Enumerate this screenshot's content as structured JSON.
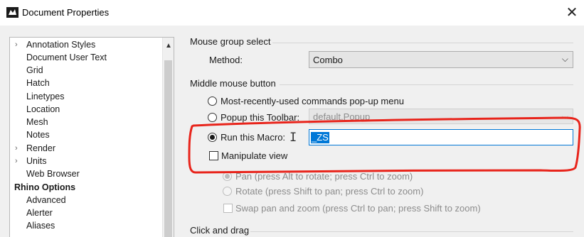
{
  "window": {
    "title": "Document Properties",
    "close_glyph": "✕"
  },
  "tree": {
    "items": [
      {
        "label": "Annotation Styles",
        "expandable": true,
        "level": 1
      },
      {
        "label": "Document User Text",
        "expandable": false,
        "level": 1
      },
      {
        "label": "Grid",
        "expandable": false,
        "level": 1
      },
      {
        "label": "Hatch",
        "expandable": false,
        "level": 1
      },
      {
        "label": "Linetypes",
        "expandable": false,
        "level": 1
      },
      {
        "label": "Location",
        "expandable": false,
        "level": 1
      },
      {
        "label": "Mesh",
        "expandable": false,
        "level": 1
      },
      {
        "label": "Notes",
        "expandable": false,
        "level": 1
      },
      {
        "label": "Render",
        "expandable": true,
        "level": 1
      },
      {
        "label": "Units",
        "expandable": true,
        "level": 1
      },
      {
        "label": "Web Browser",
        "expandable": false,
        "level": 1
      },
      {
        "label": "Rhino Options",
        "expandable": false,
        "level": 0
      },
      {
        "label": "Advanced",
        "expandable": false,
        "level": 1
      },
      {
        "label": "Alerter",
        "expandable": false,
        "level": 1
      },
      {
        "label": "Aliases",
        "expandable": false,
        "level": 1
      }
    ]
  },
  "mouse_group": {
    "title": "Mouse group select",
    "method_label": "Method:",
    "method_value": "Combo"
  },
  "middle_button": {
    "title": "Middle mouse button",
    "opt_popup_menu": "Most-recently-used commands pop-up menu",
    "opt_popup_toolbar": "Popup this Toolbar:",
    "toolbar_value": "default.Popup",
    "opt_run_macro": "Run this Macro:",
    "macro_value": "_ZS",
    "manipulate_view": "Manipulate view",
    "pan_option": "Pan (press Alt to rotate; press Ctrl to zoom)",
    "rotate_option": "Rotate (press Shift to pan; press Ctrl to zoom)",
    "swap_option": "Swap pan and zoom (press Ctrl to pan; press Shift to zoom)"
  },
  "click_drag": {
    "title": "Click and drag"
  },
  "colors": {
    "accent": "#0078d7",
    "annotation": "#e8241b"
  }
}
